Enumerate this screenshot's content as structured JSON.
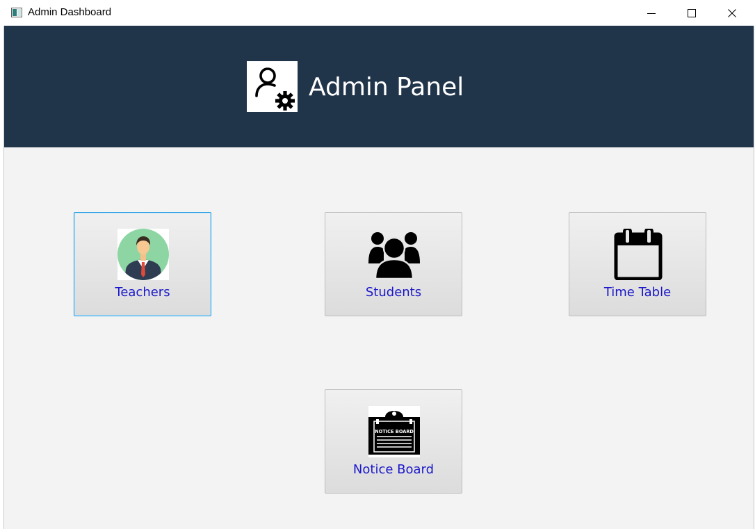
{
  "window": {
    "title": "Admin Dashboard",
    "icon": "app-window-icon",
    "controls": [
      "minimize-icon",
      "maximize-icon",
      "close-icon"
    ]
  },
  "header": {
    "title": "Admin Panel",
    "icon": "admin-gear-user-icon",
    "background": "#20344a"
  },
  "tiles": [
    {
      "label": "Teachers",
      "icon": "teacher-avatar-icon",
      "focused": true
    },
    {
      "label": "Students",
      "icon": "students-group-icon",
      "focused": false
    },
    {
      "label": "Time Table",
      "icon": "calendar-icon",
      "focused": false
    },
    {
      "label": "Notice Board",
      "icon": "notice-board-icon",
      "icon_text": "NOTICE BOARD",
      "focused": false
    }
  ],
  "colors": {
    "accent_focus": "#1e9be0",
    "tile_label": "#1a17c9",
    "content_bg": "#f3f3f3"
  }
}
